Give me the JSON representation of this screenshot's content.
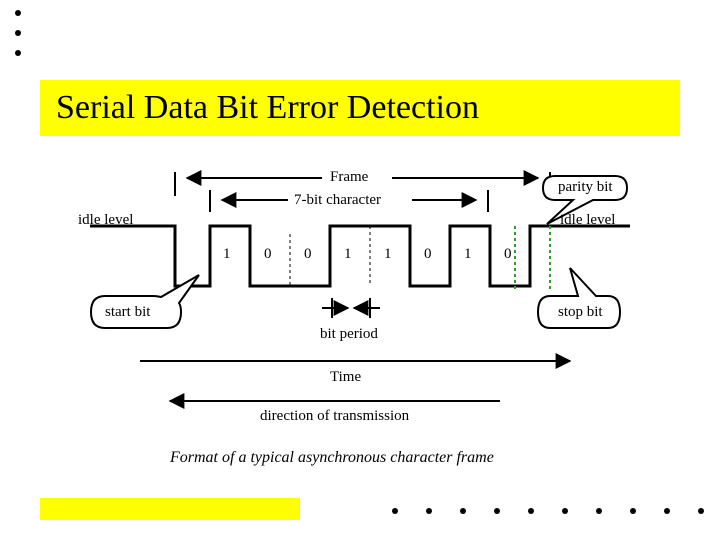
{
  "title": "Serial Data Bit Error Detection",
  "labels": {
    "frame": "Frame",
    "char": "7-bit character",
    "parity": "parity bit",
    "idle_left": "idle level",
    "idle_right": "idle level",
    "start": "start bit",
    "stop": "stop bit",
    "bit_period": "bit period",
    "time": "Time",
    "direction": "direction of transmission"
  },
  "bits": [
    "1",
    "0",
    "0",
    "1",
    "1",
    "0",
    "1",
    "0"
  ],
  "caption": "Format of a typical asynchronous character frame"
}
